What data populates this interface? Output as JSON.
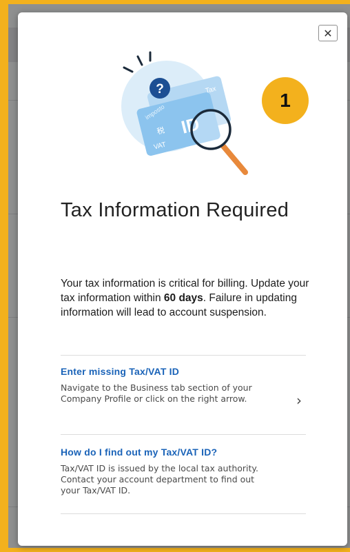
{
  "modal": {
    "close_label": "✕",
    "step_badge": "1",
    "title": "Tax Information Required",
    "body_intro": "Your tax information is critical for billing. Update your tax information within ",
    "body_bold": "60 days",
    "body_rest": ". Failure in updating information will lead to account suspension.",
    "sections": [
      {
        "title": "Enter missing Tax/VAT ID",
        "description": "Navigate to the Business tab section of your Company Profile or click on the right arrow."
      },
      {
        "title": "How do I find out my Tax/VAT ID?",
        "description": "Tax/VAT ID is issued by the local tax authority. Contact your account department to find out your Tax/VAT ID."
      }
    ]
  },
  "illustration": {
    "card_labels": [
      "Tax",
      "imposto",
      "税",
      "VAT",
      "ID"
    ],
    "question_mark": "?"
  },
  "colors": {
    "accent": "#1a63b8",
    "highlight": "#f3b11d"
  }
}
